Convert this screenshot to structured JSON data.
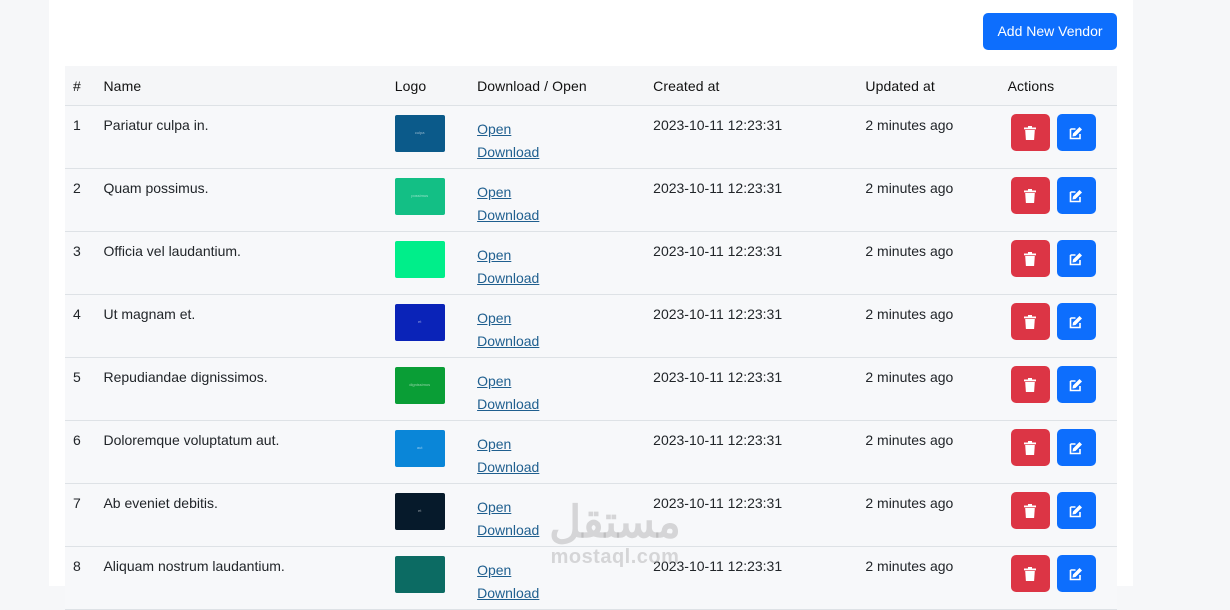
{
  "toolbar": {
    "add_label": "Add New Vendor"
  },
  "table": {
    "headers": [
      "#",
      "Name",
      "Logo",
      "Download / Open",
      "Created at",
      "Updated at",
      "Actions"
    ],
    "open_label": "Open",
    "download_label": "Download",
    "rows": [
      {
        "num": "1",
        "name": "Pariatur culpa in.",
        "logo_color": "#0b5a8a",
        "logo_text": "culpa",
        "created": "2023-10-11 12:23:31",
        "updated": "2 minutes ago"
      },
      {
        "num": "2",
        "name": "Quam possimus.",
        "logo_color": "#13bf85",
        "logo_text": "possimus",
        "created": "2023-10-11 12:23:31",
        "updated": "2 minutes ago"
      },
      {
        "num": "3",
        "name": "Officia vel laudantium.",
        "logo_color": "#00ee8a",
        "logo_text": "",
        "created": "2023-10-11 12:23:31",
        "updated": "2 minutes ago"
      },
      {
        "num": "4",
        "name": "Ut magnam et.",
        "logo_color": "#0a23b8",
        "logo_text": "et",
        "created": "2023-10-11 12:23:31",
        "updated": "2 minutes ago"
      },
      {
        "num": "5",
        "name": "Repudiandae dignissimos.",
        "logo_color": "#0a9e36",
        "logo_text": "dignissimos",
        "created": "2023-10-11 12:23:31",
        "updated": "2 minutes ago"
      },
      {
        "num": "6",
        "name": "Doloremque voluptatum aut.",
        "logo_color": "#0a86d8",
        "logo_text": "aut",
        "created": "2023-10-11 12:23:31",
        "updated": "2 minutes ago"
      },
      {
        "num": "7",
        "name": "Ab eveniet debitis.",
        "logo_color": "#061a2b",
        "logo_text": "et",
        "created": "2023-10-11 12:23:31",
        "updated": "2 minutes ago"
      },
      {
        "num": "8",
        "name": "Aliquam nostrum laudantium.",
        "logo_color": "#0c6b63",
        "logo_text": "",
        "created": "2023-10-11 12:23:31",
        "updated": "2 minutes ago"
      }
    ]
  },
  "icons": {
    "delete": "trash-icon",
    "edit": "edit-icon"
  },
  "colors": {
    "primary": "#0d6efd",
    "danger": "#dc3545",
    "link": "#1f5f8f"
  },
  "watermark": {
    "arabic": "مستقل",
    "latin": "mostaql.com"
  }
}
